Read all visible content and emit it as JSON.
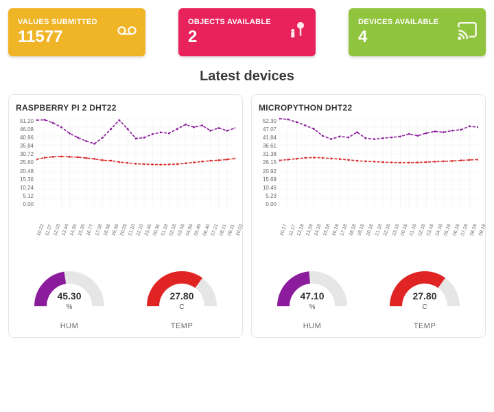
{
  "cards": [
    {
      "label": "VALUES SUBMITTED",
      "value": "11577",
      "bg": "#f0b427",
      "icon": "voicemail"
    },
    {
      "label": "OBJECTS AVAILABLE",
      "value": "2",
      "bg": "#e8235b",
      "icon": "nature-people"
    },
    {
      "label": "DEVICES AVAILABLE",
      "value": "4",
      "bg": "#91c43e",
      "icon": "cast"
    }
  ],
  "section_title": "Latest devices",
  "devices": [
    {
      "title": "RASPBERRY PI 2 DHT22",
      "chart": {
        "ymax": 51.2,
        "yticks": [
          "51.20",
          "46.08",
          "40.96",
          "35.84",
          "30.72",
          "25.60",
          "20.48",
          "15.36",
          "10.24",
          "5.12",
          "0.00"
        ],
        "xticks": [
          "10.22",
          "11.27",
          "12.03",
          "13.34",
          "14.35",
          "15.35",
          "16.77",
          "17.08",
          "18.58",
          "19.39",
          "20.29",
          "21.10",
          "22.10",
          "23.45",
          "00.36",
          "01.18",
          "02.18",
          "03.18",
          "04.59",
          "05.49",
          "06.40",
          "07.21",
          "08.21",
          "09.11",
          "10.02"
        ],
        "series": [
          {
            "name": "HUM",
            "color": "#8b1c9c",
            "values": [
              50.0,
              50.2,
              48.5,
              46.0,
              42.5,
              40.0,
              38.0,
              36.5,
              40.0,
              45.0,
              50.0,
              45.0,
              39.5,
              40.0,
              42.0,
              43.0,
              42.5,
              45.0,
              47.5,
              46.0,
              47.0,
              44.0,
              45.5,
              44.0,
              45.5
            ]
          },
          {
            "name": "TEMP",
            "color": "#d82a2a",
            "values": [
              27.5,
              28.5,
              29.0,
              29.2,
              29.0,
              28.8,
              28.3,
              27.8,
              27.0,
              26.8,
              26.0,
              25.5,
              25.0,
              24.8,
              24.6,
              24.5,
              24.6,
              24.8,
              25.3,
              25.8,
              26.3,
              26.8,
              27.0,
              27.5,
              28.0
            ]
          }
        ]
      },
      "gauges": [
        {
          "label": "HUM",
          "value": "45.30",
          "unit": "%",
          "color": "#8b1c9c",
          "fraction": 0.453
        },
        {
          "label": "TEMP",
          "value": "27.80",
          "unit": "C",
          "color": "#e02424",
          "fraction": 0.7
        }
      ]
    },
    {
      "title": "MICROPYTHON DHT22",
      "chart": {
        "ymax": 52.3,
        "yticks": [
          "52.30",
          "47.07",
          "41.84",
          "36.61",
          "31.38",
          "26.15",
          "20.92",
          "15.69",
          "10.46",
          "5.23",
          "0.00"
        ],
        "xticks": [
          "10.17",
          "11.17",
          "12.18",
          "13.18",
          "14.18",
          "15.18",
          "16.18",
          "17.18",
          "18.18",
          "19.18",
          "20.18",
          "21.18",
          "22.18",
          "23.18",
          "00.18",
          "01.18",
          "02.18",
          "03.18",
          "04.18",
          "05.18",
          "06.18",
          "07.18",
          "08.18",
          "09.18"
        ],
        "series": [
          {
            "name": "HUM",
            "color": "#8b1c9c",
            "values": [
              52.0,
              51.5,
              50.0,
              48.0,
              46.0,
              42.0,
              40.0,
              41.5,
              41.0,
              44.0,
              40.5,
              40.0,
              40.5,
              41.0,
              41.5,
              43.0,
              42.0,
              43.5,
              44.5,
              44.0,
              45.0,
              45.5,
              47.5,
              47.0
            ]
          },
          {
            "name": "TEMP",
            "color": "#d82a2a",
            "values": [
              27.5,
              28.0,
              28.5,
              29.0,
              29.2,
              29.0,
              28.6,
              28.3,
              27.8,
              27.3,
              27.0,
              26.8,
              26.5,
              26.3,
              26.2,
              26.2,
              26.3,
              26.5,
              26.8,
              27.0,
              27.2,
              27.5,
              27.8,
              28.0
            ]
          }
        ]
      },
      "gauges": [
        {
          "label": "HUM",
          "value": "47.10",
          "unit": "%",
          "color": "#8b1c9c",
          "fraction": 0.471
        },
        {
          "label": "TEMP",
          "value": "27.80",
          "unit": "C",
          "color": "#e02424",
          "fraction": 0.7
        }
      ]
    }
  ],
  "chart_data": [
    {
      "type": "line",
      "title": "RASPBERRY PI 2 DHT22",
      "xlabel": "",
      "ylabel": "",
      "ylim": [
        0,
        51.2
      ],
      "x": [
        "10.22",
        "11.27",
        "12.03",
        "13.34",
        "14.35",
        "15.35",
        "16.77",
        "17.08",
        "18.58",
        "19.39",
        "20.29",
        "21.10",
        "22.10",
        "23.45",
        "00.36",
        "01.18",
        "02.18",
        "03.18",
        "04.59",
        "05.49",
        "06.40",
        "07.21",
        "08.21",
        "09.11",
        "10.02"
      ],
      "series": [
        {
          "name": "HUM %",
          "values": [
            50.0,
            50.2,
            48.5,
            46.0,
            42.5,
            40.0,
            38.0,
            36.5,
            40.0,
            45.0,
            50.0,
            45.0,
            39.5,
            40.0,
            42.0,
            43.0,
            42.5,
            45.0,
            47.5,
            46.0,
            47.0,
            44.0,
            45.5,
            44.0,
            45.5
          ]
        },
        {
          "name": "TEMP C",
          "values": [
            27.5,
            28.5,
            29.0,
            29.2,
            29.0,
            28.8,
            28.3,
            27.8,
            27.0,
            26.8,
            26.0,
            25.5,
            25.0,
            24.8,
            24.6,
            24.5,
            24.6,
            24.8,
            25.3,
            25.8,
            26.3,
            26.8,
            27.0,
            27.5,
            28.0
          ]
        }
      ]
    },
    {
      "type": "line",
      "title": "MICROPYTHON DHT22",
      "xlabel": "",
      "ylabel": "",
      "ylim": [
        0,
        52.3
      ],
      "x": [
        "10.17",
        "11.17",
        "12.18",
        "13.18",
        "14.18",
        "15.18",
        "16.18",
        "17.18",
        "18.18",
        "19.18",
        "20.18",
        "21.18",
        "22.18",
        "23.18",
        "00.18",
        "01.18",
        "02.18",
        "03.18",
        "04.18",
        "05.18",
        "06.18",
        "07.18",
        "08.18",
        "09.18"
      ],
      "series": [
        {
          "name": "HUM %",
          "values": [
            52.0,
            51.5,
            50.0,
            48.0,
            46.0,
            42.0,
            40.0,
            41.5,
            41.0,
            44.0,
            40.5,
            40.0,
            40.5,
            41.0,
            41.5,
            43.0,
            42.0,
            43.5,
            44.5,
            44.0,
            45.0,
            45.5,
            47.5,
            47.0
          ]
        },
        {
          "name": "TEMP C",
          "values": [
            27.5,
            28.0,
            28.5,
            29.0,
            29.2,
            29.0,
            28.6,
            28.3,
            27.8,
            27.3,
            27.0,
            26.8,
            26.5,
            26.3,
            26.2,
            26.2,
            26.3,
            26.5,
            26.8,
            27.0,
            27.2,
            27.5,
            27.8,
            28.0
          ]
        }
      ]
    },
    {
      "type": "pie",
      "title": "HUM",
      "categories": [
        "value",
        "remaining"
      ],
      "values": [
        45.3,
        54.7
      ]
    },
    {
      "type": "pie",
      "title": "TEMP",
      "categories": [
        "value",
        "remaining"
      ],
      "values": [
        27.8,
        12.2
      ]
    },
    {
      "type": "pie",
      "title": "HUM",
      "categories": [
        "value",
        "remaining"
      ],
      "values": [
        47.1,
        52.9
      ]
    },
    {
      "type": "pie",
      "title": "TEMP",
      "categories": [
        "value",
        "remaining"
      ],
      "values": [
        27.8,
        12.2
      ]
    }
  ]
}
